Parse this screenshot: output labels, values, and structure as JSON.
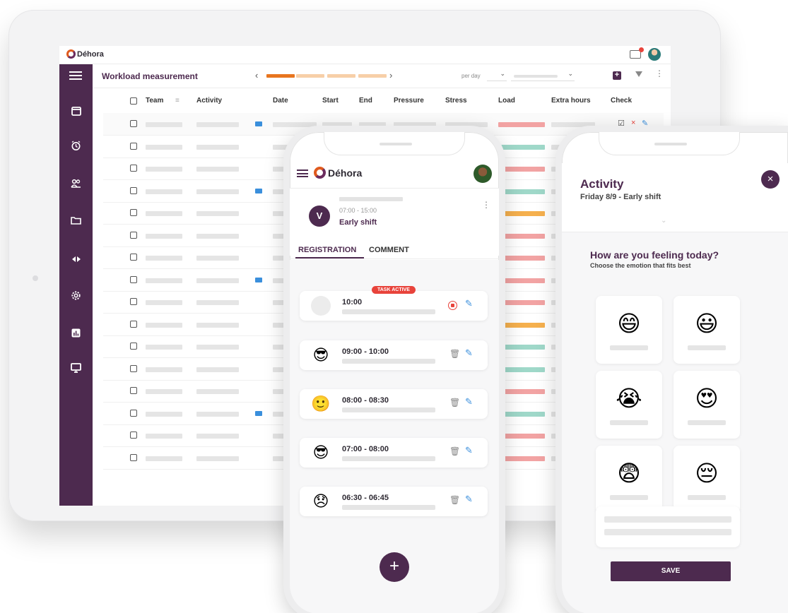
{
  "tablet": {
    "logo": "Déhora",
    "toolbar": {
      "title": "Workload measurement",
      "prev": "‹",
      "next": "›",
      "per_day": "per day"
    },
    "columns": [
      "Team",
      "Activity",
      "Date",
      "Start",
      "End",
      "Pressure",
      "Stress",
      "Load",
      "Extra hours",
      "Check"
    ],
    "row_count": 16,
    "load_colors": [
      "#f2a3a3",
      "#9fd8c9",
      "#f2a3a3",
      "#9fd8c9",
      "#f5b04e",
      "#f2a3a3",
      "#f2a3a3",
      "#f2a3a3",
      "#f2a3a3",
      "#f5b04e",
      "#9fd8c9",
      "#9fd8c9",
      "#f2a3a3",
      "#9fd8c9",
      "#f2a3a3",
      "#f2a3a3"
    ],
    "check": {
      "ok_icon": "☑",
      "reject_icon": "×",
      "edit_icon": "✎"
    }
  },
  "phone_registration": {
    "logo": "Déhora",
    "shift": {
      "initial": "V",
      "time": "07:00 - 15:00",
      "name": "Early shift"
    },
    "tabs": [
      "REGISTRATION",
      "COMMENT"
    ],
    "active_task": {
      "badge": "TASK ACTIVE",
      "time": "10:00"
    },
    "entries": [
      {
        "time": "09:00 - 10:00",
        "emoji": "😎"
      },
      {
        "time": "08:00 - 08:30",
        "emoji": "🙂"
      },
      {
        "time": "07:00 - 08:00",
        "emoji": "😎"
      },
      {
        "time": "06:30 - 06:45",
        "emoji": "😞"
      }
    ],
    "fab": "+"
  },
  "phone_activity": {
    "title": "Activity",
    "subtitle": "Friday 8/9 - Early shift",
    "question": "How are you feeling today?",
    "hint": "Choose the emotion that fits best",
    "emotions": [
      "😄",
      "😃",
      "😭",
      "😍",
      "😨",
      "😔"
    ],
    "close": "×",
    "save": "SAVE"
  },
  "colors": {
    "brand": "#4d2a4f",
    "accent": "#e05a1e",
    "danger": "#e8433b",
    "link": "#3a8fdc"
  }
}
